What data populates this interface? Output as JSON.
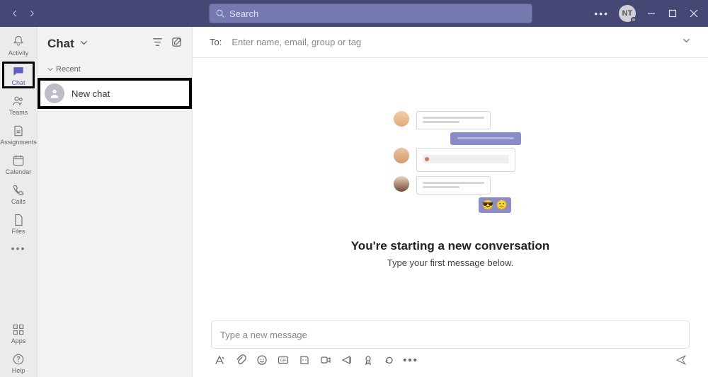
{
  "titlebar": {
    "search_placeholder": "Search",
    "user_initials": "NT"
  },
  "rail": {
    "items": [
      {
        "id": "activity",
        "label": "Activity"
      },
      {
        "id": "chat",
        "label": "Chat"
      },
      {
        "id": "teams",
        "label": "Teams"
      },
      {
        "id": "assignments",
        "label": "Assignments"
      },
      {
        "id": "calendar",
        "label": "Calendar"
      },
      {
        "id": "calls",
        "label": "Calls"
      },
      {
        "id": "files",
        "label": "Files"
      }
    ],
    "bottom": [
      {
        "id": "apps",
        "label": "Apps"
      },
      {
        "id": "help",
        "label": "Help"
      }
    ]
  },
  "chatlist": {
    "title": "Chat",
    "section_recent": "Recent",
    "items": [
      {
        "name": "New chat"
      }
    ]
  },
  "to_bar": {
    "label": "To:",
    "placeholder": "Enter name, email, group or tag"
  },
  "empty_state": {
    "title": "You're starting a new conversation",
    "subtitle": "Type your first message below."
  },
  "composer": {
    "placeholder": "Type a new message"
  }
}
